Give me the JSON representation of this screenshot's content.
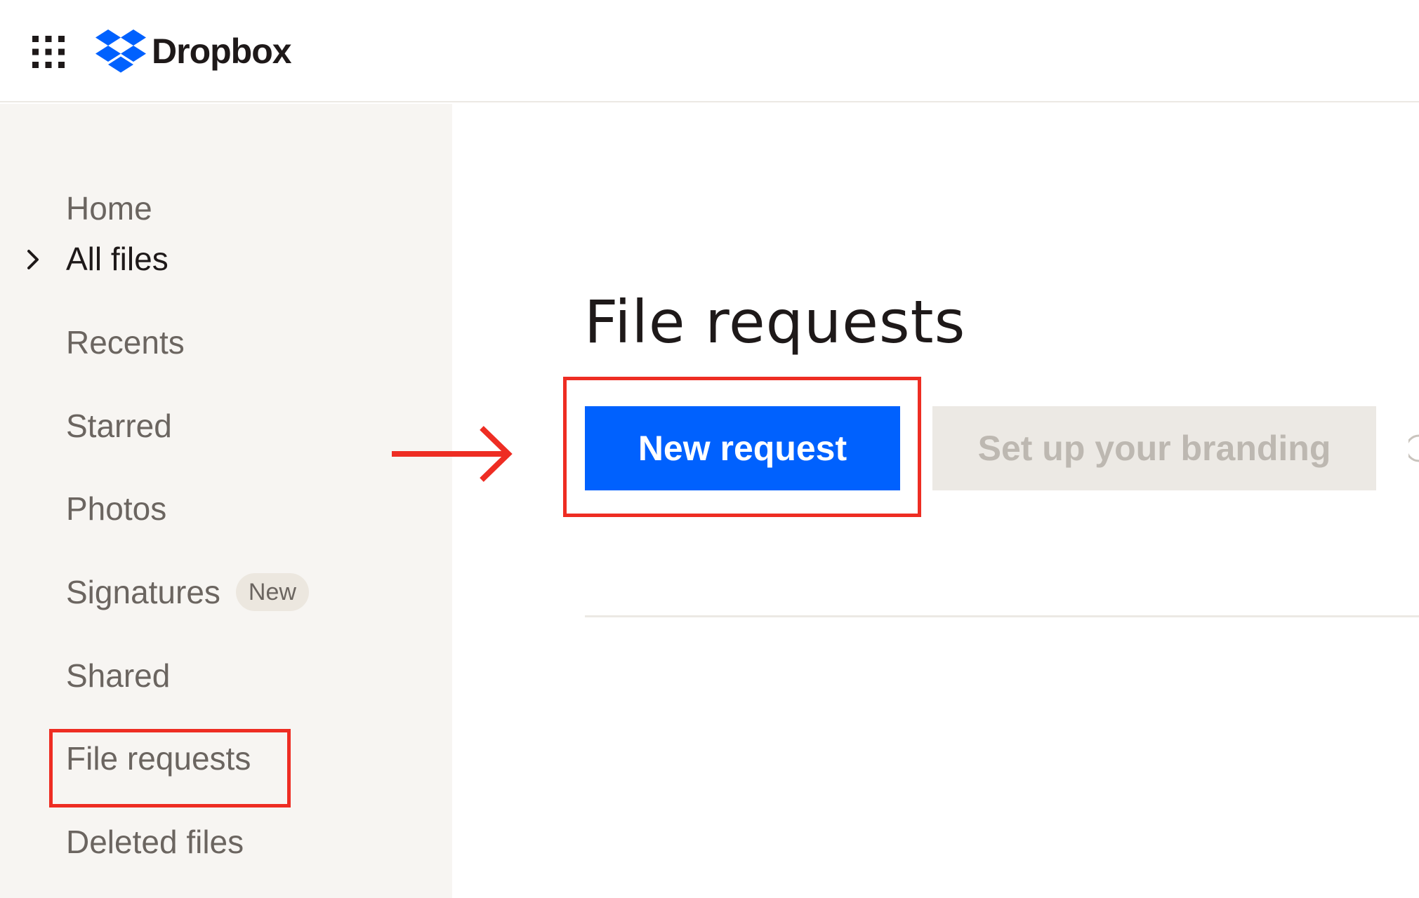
{
  "header": {
    "app_grid_icon": "app-grid-icon",
    "brand_name": "Dropbox",
    "brand_color": "#0061fe"
  },
  "sidebar": {
    "items": [
      {
        "label": "Home"
      },
      {
        "label": "All files",
        "icon": "chevron-right-icon",
        "active": true
      },
      {
        "label": "Recents"
      },
      {
        "label": "Starred"
      },
      {
        "label": "Photos"
      },
      {
        "label": "Signatures",
        "badge": "New"
      },
      {
        "label": "Shared"
      },
      {
        "label": "File requests",
        "highlighted": true
      },
      {
        "label": "Deleted files"
      }
    ]
  },
  "main": {
    "title": "File requests",
    "new_request_label": "New request",
    "branding_label": "Set up your branding"
  },
  "annotations": {
    "highlight_color": "#ee2d23",
    "arrow_icon": "arrow-right-icon"
  }
}
